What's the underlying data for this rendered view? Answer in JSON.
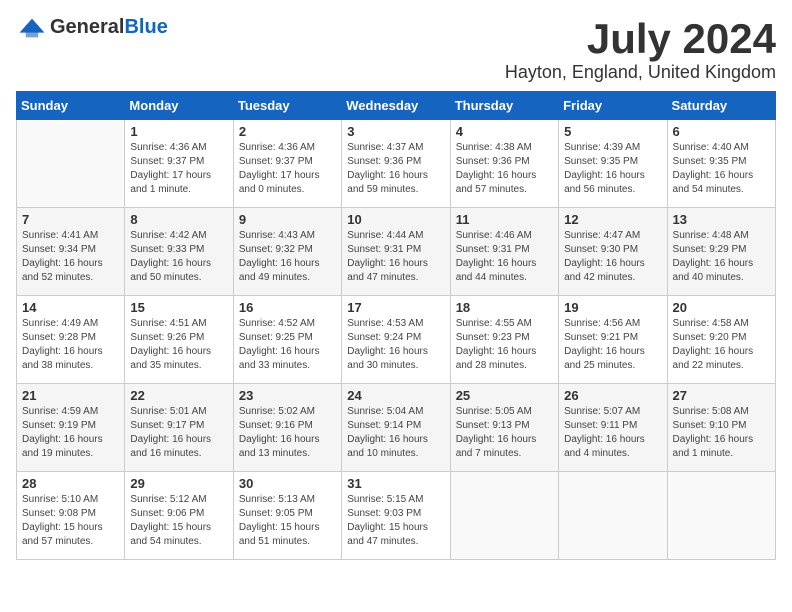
{
  "header": {
    "logo_general": "General",
    "logo_blue": "Blue",
    "month": "July 2024",
    "location": "Hayton, England, United Kingdom"
  },
  "weekdays": [
    "Sunday",
    "Monday",
    "Tuesday",
    "Wednesday",
    "Thursday",
    "Friday",
    "Saturday"
  ],
  "weeks": [
    [
      {
        "day": "",
        "empty": true
      },
      {
        "day": "1",
        "sunrise": "Sunrise: 4:36 AM",
        "sunset": "Sunset: 9:37 PM",
        "daylight": "Daylight: 17 hours and 1 minute."
      },
      {
        "day": "2",
        "sunrise": "Sunrise: 4:36 AM",
        "sunset": "Sunset: 9:37 PM",
        "daylight": "Daylight: 17 hours and 0 minutes."
      },
      {
        "day": "3",
        "sunrise": "Sunrise: 4:37 AM",
        "sunset": "Sunset: 9:36 PM",
        "daylight": "Daylight: 16 hours and 59 minutes."
      },
      {
        "day": "4",
        "sunrise": "Sunrise: 4:38 AM",
        "sunset": "Sunset: 9:36 PM",
        "daylight": "Daylight: 16 hours and 57 minutes."
      },
      {
        "day": "5",
        "sunrise": "Sunrise: 4:39 AM",
        "sunset": "Sunset: 9:35 PM",
        "daylight": "Daylight: 16 hours and 56 minutes."
      },
      {
        "day": "6",
        "sunrise": "Sunrise: 4:40 AM",
        "sunset": "Sunset: 9:35 PM",
        "daylight": "Daylight: 16 hours and 54 minutes."
      }
    ],
    [
      {
        "day": "7",
        "sunrise": "Sunrise: 4:41 AM",
        "sunset": "Sunset: 9:34 PM",
        "daylight": "Daylight: 16 hours and 52 minutes."
      },
      {
        "day": "8",
        "sunrise": "Sunrise: 4:42 AM",
        "sunset": "Sunset: 9:33 PM",
        "daylight": "Daylight: 16 hours and 50 minutes."
      },
      {
        "day": "9",
        "sunrise": "Sunrise: 4:43 AM",
        "sunset": "Sunset: 9:32 PM",
        "daylight": "Daylight: 16 hours and 49 minutes."
      },
      {
        "day": "10",
        "sunrise": "Sunrise: 4:44 AM",
        "sunset": "Sunset: 9:31 PM",
        "daylight": "Daylight: 16 hours and 47 minutes."
      },
      {
        "day": "11",
        "sunrise": "Sunrise: 4:46 AM",
        "sunset": "Sunset: 9:31 PM",
        "daylight": "Daylight: 16 hours and 44 minutes."
      },
      {
        "day": "12",
        "sunrise": "Sunrise: 4:47 AM",
        "sunset": "Sunset: 9:30 PM",
        "daylight": "Daylight: 16 hours and 42 minutes."
      },
      {
        "day": "13",
        "sunrise": "Sunrise: 4:48 AM",
        "sunset": "Sunset: 9:29 PM",
        "daylight": "Daylight: 16 hours and 40 minutes."
      }
    ],
    [
      {
        "day": "14",
        "sunrise": "Sunrise: 4:49 AM",
        "sunset": "Sunset: 9:28 PM",
        "daylight": "Daylight: 16 hours and 38 minutes."
      },
      {
        "day": "15",
        "sunrise": "Sunrise: 4:51 AM",
        "sunset": "Sunset: 9:26 PM",
        "daylight": "Daylight: 16 hours and 35 minutes."
      },
      {
        "day": "16",
        "sunrise": "Sunrise: 4:52 AM",
        "sunset": "Sunset: 9:25 PM",
        "daylight": "Daylight: 16 hours and 33 minutes."
      },
      {
        "day": "17",
        "sunrise": "Sunrise: 4:53 AM",
        "sunset": "Sunset: 9:24 PM",
        "daylight": "Daylight: 16 hours and 30 minutes."
      },
      {
        "day": "18",
        "sunrise": "Sunrise: 4:55 AM",
        "sunset": "Sunset: 9:23 PM",
        "daylight": "Daylight: 16 hours and 28 minutes."
      },
      {
        "day": "19",
        "sunrise": "Sunrise: 4:56 AM",
        "sunset": "Sunset: 9:21 PM",
        "daylight": "Daylight: 16 hours and 25 minutes."
      },
      {
        "day": "20",
        "sunrise": "Sunrise: 4:58 AM",
        "sunset": "Sunset: 9:20 PM",
        "daylight": "Daylight: 16 hours and 22 minutes."
      }
    ],
    [
      {
        "day": "21",
        "sunrise": "Sunrise: 4:59 AM",
        "sunset": "Sunset: 9:19 PM",
        "daylight": "Daylight: 16 hours and 19 minutes."
      },
      {
        "day": "22",
        "sunrise": "Sunrise: 5:01 AM",
        "sunset": "Sunset: 9:17 PM",
        "daylight": "Daylight: 16 hours and 16 minutes."
      },
      {
        "day": "23",
        "sunrise": "Sunrise: 5:02 AM",
        "sunset": "Sunset: 9:16 PM",
        "daylight": "Daylight: 16 hours and 13 minutes."
      },
      {
        "day": "24",
        "sunrise": "Sunrise: 5:04 AM",
        "sunset": "Sunset: 9:14 PM",
        "daylight": "Daylight: 16 hours and 10 minutes."
      },
      {
        "day": "25",
        "sunrise": "Sunrise: 5:05 AM",
        "sunset": "Sunset: 9:13 PM",
        "daylight": "Daylight: 16 hours and 7 minutes."
      },
      {
        "day": "26",
        "sunrise": "Sunrise: 5:07 AM",
        "sunset": "Sunset: 9:11 PM",
        "daylight": "Daylight: 16 hours and 4 minutes."
      },
      {
        "day": "27",
        "sunrise": "Sunrise: 5:08 AM",
        "sunset": "Sunset: 9:10 PM",
        "daylight": "Daylight: 16 hours and 1 minute."
      }
    ],
    [
      {
        "day": "28",
        "sunrise": "Sunrise: 5:10 AM",
        "sunset": "Sunset: 9:08 PM",
        "daylight": "Daylight: 15 hours and 57 minutes."
      },
      {
        "day": "29",
        "sunrise": "Sunrise: 5:12 AM",
        "sunset": "Sunset: 9:06 PM",
        "daylight": "Daylight: 15 hours and 54 minutes."
      },
      {
        "day": "30",
        "sunrise": "Sunrise: 5:13 AM",
        "sunset": "Sunset: 9:05 PM",
        "daylight": "Daylight: 15 hours and 51 minutes."
      },
      {
        "day": "31",
        "sunrise": "Sunrise: 5:15 AM",
        "sunset": "Sunset: 9:03 PM",
        "daylight": "Daylight: 15 hours and 47 minutes."
      },
      {
        "day": "",
        "empty": true
      },
      {
        "day": "",
        "empty": true
      },
      {
        "day": "",
        "empty": true
      }
    ]
  ]
}
